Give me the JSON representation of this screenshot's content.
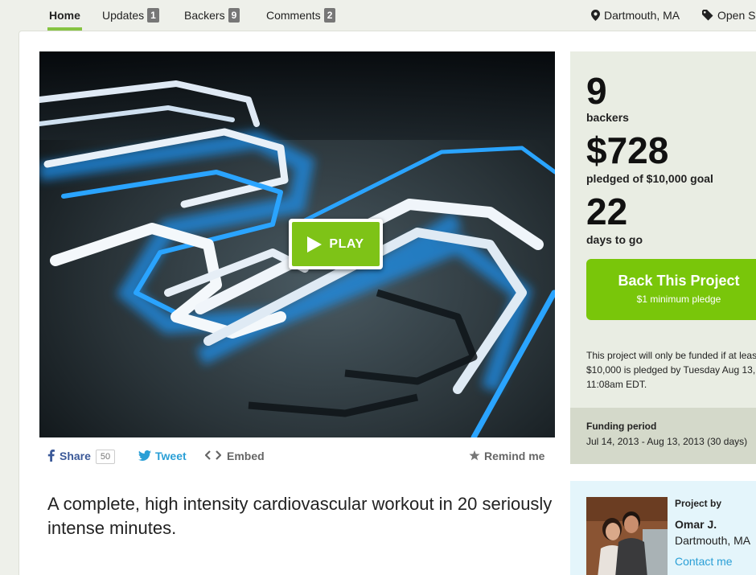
{
  "nav": {
    "tabs": [
      {
        "label": "Home"
      },
      {
        "label": "Updates",
        "count": "1"
      },
      {
        "label": "Backers",
        "count": "9"
      },
      {
        "label": "Comments",
        "count": "2"
      }
    ],
    "location": "Dartmouth, MA",
    "category": "Open S"
  },
  "video": {
    "play_label": "PLAY"
  },
  "share": {
    "facebook_label": "Share",
    "facebook_count": "50",
    "tweet_label": "Tweet",
    "embed_label": "Embed",
    "remind_label": "Remind me"
  },
  "blurb": "A complete, high intensity cardiovascular workout in 20 seriously intense minutes.",
  "stats": {
    "backers_count": "9",
    "backers_label": "backers",
    "pledged_amount": "$728",
    "pledged_label": "pledged of $10,000 goal",
    "days_count": "22",
    "days_label": "days to go",
    "back_button": "Back This Project",
    "minimum_pledge": "$1 minimum pledge",
    "funding_note": "This project will only be funded if at leas $10,000 is pledged by Tuesday Aug 13, 11:08am EDT.",
    "funding_period_heading": "Funding period",
    "funding_period_value": "Jul 14, 2013 - Aug 13, 2013 (30 days)"
  },
  "creator": {
    "project_by": "Project by",
    "name": "Omar J.",
    "location": "Dartmouth, MA",
    "contact": "Contact me"
  },
  "colors": {
    "accent_green": "#79c60a",
    "link_blue": "#2a9fd6",
    "facebook_blue": "#3b5998",
    "sidebar_bg": "#e9ede3",
    "creator_bg": "#e4f5fb"
  }
}
